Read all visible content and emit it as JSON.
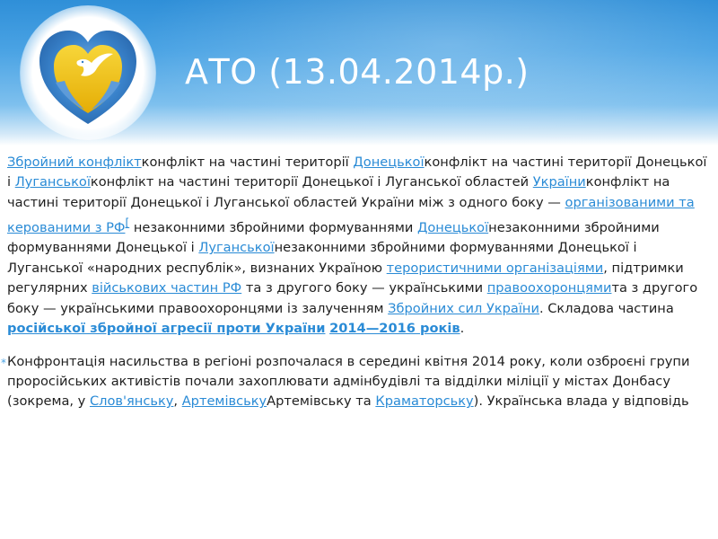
{
  "slide": {
    "title": "АТО (13.04.2014р.)"
  },
  "colors": {
    "header_top": "#2f8fd8",
    "header_bottom": "#d4e9f8",
    "link": "#2a8bd6",
    "heart_blue": "#2f7cc8",
    "heart_yellow": "#f2c40c"
  },
  "logo": {
    "icon": "heart-dove-icon"
  },
  "paragraph1": {
    "l1": "Збройний конфлікт",
    "t1": "конфлікт на частині території ",
    "l2": "Донецької",
    "t2": "конфлікт на частині території Донецької і ",
    "l3": "Луганської",
    "t3": "конфлікт на частині території Донецької і Луганської областей ",
    "l4": "України",
    "t4": "конфлікт на частині території Донецької і Луганської областей України між з одного боку — ",
    "l5": "організованими та керованими з РФ",
    "l5sup": "[",
    "t5": " незаконними збройними формуваннями ",
    "l6": "Донецької",
    "t6": "незаконними збройними формуваннями Донецької і ",
    "l7": "Луганської",
    "t7": "незаконними збройними формуваннями Донецької і Луганської «народних республік», визнаних Україною ",
    "l8": "терористичними організаціями",
    "t8": ", підтримки регулярних ",
    "l9": "військових частин РФ",
    "t9": " та з другого боку — українськими ",
    "l10": "правоохоронцями",
    "t10": "та з другого боку — українськими правоохоронцями із залученням ",
    "l11": "Збройних сил України",
    "t11": ". Складова частина ",
    "l12": "російської збройної агресії проти України",
    "t12": " ",
    "l13": "2014—2016 років",
    "t13": "."
  },
  "paragraph2": {
    "t1": "Конфронтація насильства в регіоні розпочалася в середині квітня 2014 року, коли озброєні групи проросійських активістів почали захоплювати адмінбудівлі та відділки міліції у містах Донбасу (зокрема, у ",
    "l1": "Слов'янську",
    "sep": ", ",
    "l2": "Артемівську",
    "t2": "Артемівську та ",
    "l3": "Краматорську",
    "t3": "). Українська влада у відповідь"
  }
}
